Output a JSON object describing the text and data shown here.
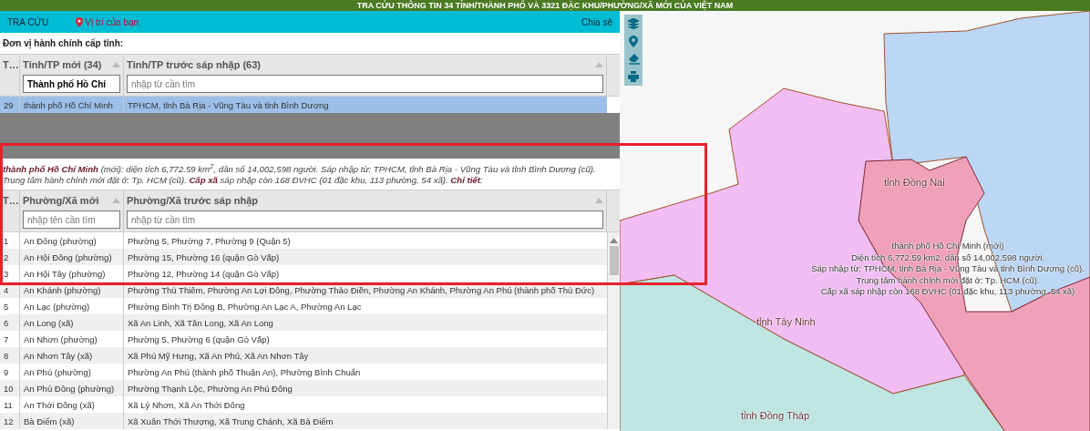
{
  "app_title": "TRA CỨU THÔNG TIN 34 TỈNH/THÀNH PHỐ VÀ 3321 ĐẶC KHU/PHƯỜNG/XÃ MỚI CỦA VIỆT NAM",
  "nav": {
    "search_tab": "TRA CỨU",
    "location_link": "Vị trí của bạn",
    "share": "Chia sẻ"
  },
  "province_section": {
    "label": "Đơn vị hành chính cấp tỉnh:",
    "columns": [
      "T…",
      "Tỉnh/TP mới (34)",
      "Tỉnh/TP trước sáp nhập (63)"
    ],
    "filters": [
      {
        "value": "Thành phố Hồ Chí"
      },
      {
        "placeholder": "nhập từ cần tìm"
      }
    ],
    "rows": [
      {
        "cells": [
          "29",
          "thành phố Hồ Chí Minh",
          "TPHCM, tỉnh Bà Rịa - Vũng Tàu và tỉnh Bình Dương"
        ],
        "selected": true
      }
    ]
  },
  "ward_section": {
    "info": "**thành phố Hồ Chí Minh** (mới): diện tích 6,772.59 km$^{2}$, dân số 14,002,598 người. Sáp nhập từ: TPHCM, tỉnh Bà Rịa - Vũng Tàu và tỉnh Bình Dương (cũ). Trung tâm hành chính mới đặt ở: Tp. HCM (cũ). **Cấp xã** sáp nhập còn 168 ĐVHC (01 đặc khu, 113 phường, 54 xã). **Chi tiết**:",
    "columns": [
      "T…",
      "Phường/Xã mới",
      "Phường/Xã trước sáp nhập"
    ],
    "filters": [
      {
        "placeholder": "nhập tên cần tìm"
      },
      {
        "placeholder": "nhập từ cần tìm"
      }
    ],
    "rows": [
      {
        "cells": [
          "1",
          "An Đông (phường)",
          "Phường 5, Phường 7, Phường 9 (Quận 5)"
        ],
        "selected": false
      },
      {
        "cells": [
          "2",
          "An Hội Đông (phường)",
          "Phường 15, Phường 16 (quận Gò Vấp)"
        ],
        "selected": false
      },
      {
        "cells": [
          "3",
          "An Hội Tây (phường)",
          "Phường 12, Phường 14 (quận Gò Vấp)"
        ],
        "selected": false
      },
      {
        "cells": [
          "4",
          "An Khánh (phường)",
          "Phường Thủ Thiêm, Phường An Lợi Đông, Phường Thảo Điền, Phường An Khánh, Phường An Phú (thành phố Thủ Đức)"
        ],
        "selected": false
      },
      {
        "cells": [
          "5",
          "An Lạc (phường)",
          "Phường Bình Trị Đông B, Phường An Lạc A, Phường An Lạc"
        ],
        "selected": false
      },
      {
        "cells": [
          "6",
          "An Long (xã)",
          "Xã An Linh, Xã Tân Long, Xã An Long"
        ],
        "selected": false
      },
      {
        "cells": [
          "7",
          "An Nhơn (phường)",
          "Phường 5, Phường 6 (quận Gò Vấp)"
        ],
        "selected": false
      },
      {
        "cells": [
          "8",
          "An Nhơn Tây (xã)",
          "Xã Phú Mỹ Hưng, Xã An Phú, Xã An Nhơn Tây"
        ],
        "selected": false
      },
      {
        "cells": [
          "9",
          "An Phú (phường)",
          "Phường An Phú (thành phố Thuận An), Phường Bình Chuẩn"
        ],
        "selected": false
      },
      {
        "cells": [
          "10",
          "An Phú Đông (phường)",
          "Phường Thạnh Lộc, Phường An Phú Đông"
        ],
        "selected": false
      },
      {
        "cells": [
          "11",
          "An Thới Đông (xã)",
          "Xã Lý Nhơn, Xã An Thới Đông"
        ],
        "selected": false
      },
      {
        "cells": [
          "12",
          "Bà Điểm (xã)",
          "Xã Xuân Thới Thượng, Xã Trung Chánh, Xã Bà Điểm"
        ],
        "selected": false
      }
    ]
  },
  "map": {
    "labels": [
      "tỉnh Đồng Nai",
      "tỉnh Tây Ninh",
      "tỉnh Đồng Tháp"
    ],
    "popup": [
      "thành phố Hồ Chí Minh (mới)",
      "Diện tích 6,772.59 km2, dân số 14,002,598 người.",
      "Sáp nhập từ: TPHCM, tỉnh Bà Rịa - Vũng Tàu và tỉnh Bình Dương (cũ).",
      "Trung tâm hành chính mới đặt ở: Tp. HCM (cũ).",
      "Cấp xã sáp nhập còn 168 ĐVHC (01 đặc khu, 113 phường, 54 xã)"
    ]
  }
}
